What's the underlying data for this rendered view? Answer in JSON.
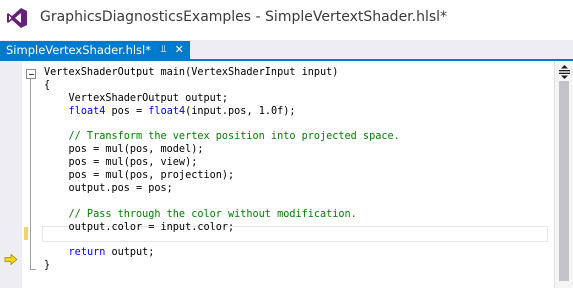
{
  "window": {
    "title": "GraphicsDiagnosticsExamples - SimpleVertextShader.hlsl*",
    "logo_icon": "visual-studio-logo-icon"
  },
  "tab": {
    "label": "SimpleVertexShader.hlsl*",
    "pin_icon": "pin-icon",
    "close_icon": "close-icon",
    "accent_color": "#007acc"
  },
  "editor": {
    "lines": [
      {
        "text": "VertexShaderOutput main(VertexShaderInput input)",
        "style": "plain"
      },
      {
        "text": "{",
        "style": "plain"
      },
      {
        "text": "    VertexShaderOutput output;",
        "style": "plain"
      },
      {
        "kw": "float4",
        "text": " pos = ",
        "kw2": "float4",
        "text2": "(input.pos, 1.0f);",
        "indent": "    "
      },
      {
        "text": "",
        "style": "plain"
      },
      {
        "text": "    // Transform the vertex position into projected space.",
        "style": "comment"
      },
      {
        "text": "    pos = mul(pos, model);",
        "style": "plain"
      },
      {
        "text": "    pos = mul(pos, view);",
        "style": "plain"
      },
      {
        "text": "    pos = mul(pos, projection);",
        "style": "plain"
      },
      {
        "text": "    output.pos = pos;",
        "style": "plain"
      },
      {
        "text": "",
        "style": "plain"
      },
      {
        "text": "    // Pass through the color without modification.",
        "style": "comment"
      },
      {
        "text": "    output.color = input.color;",
        "style": "plain"
      },
      {
        "text": "",
        "style": "plain"
      },
      {
        "kw": "return",
        "text": " output;",
        "indent": "    "
      },
      {
        "text": "}",
        "style": "plain"
      }
    ],
    "current_line": 13,
    "execution_pointer_line": 15,
    "colors": {
      "keyword": "#0000ff",
      "comment": "#008000",
      "change_marker": "#f1d26b",
      "pointer": "#f5d80f"
    }
  }
}
